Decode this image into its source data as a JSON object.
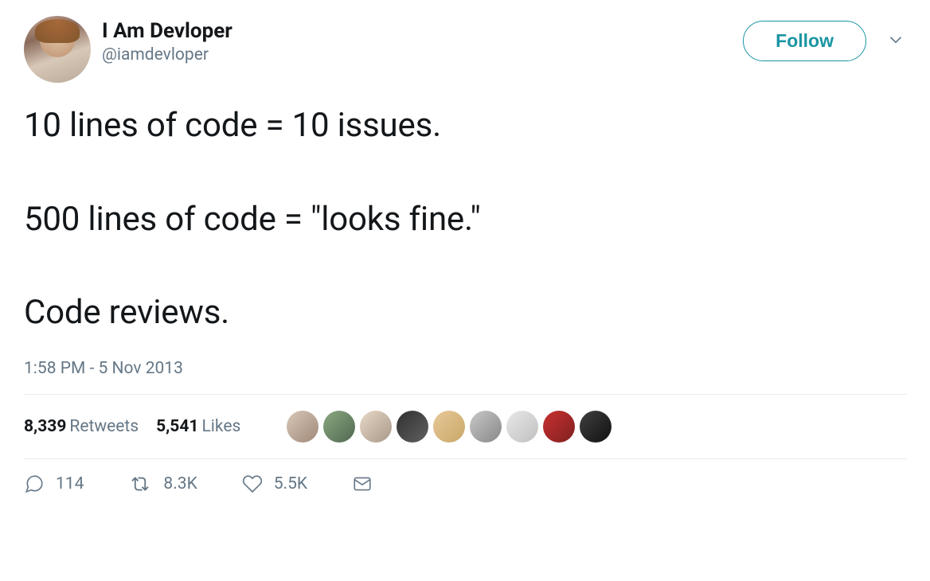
{
  "author": {
    "display_name": "I Am Devloper",
    "handle": "@iamdevloper"
  },
  "follow_label": "Follow",
  "tweet_text": "10 lines of code = 10 issues.\n\n500 lines of code = \"looks fine.\"\n\nCode reviews.",
  "timestamp": "1:58 PM - 5 Nov 2013",
  "stats": {
    "retweets_count": "8,339",
    "retweets_label": "Retweets",
    "likes_count": "5,541",
    "likes_label": "Likes"
  },
  "actions": {
    "replies": "114",
    "retweets": "8.3K",
    "likes": "5.5K"
  },
  "liker_colors": [
    "linear-gradient(135deg,#d8c8b8,#a08878)",
    "linear-gradient(135deg,#8aa880,#506850)",
    "linear-gradient(135deg,#e8d8c8,#a89888)",
    "linear-gradient(135deg,#303030,#606060)",
    "linear-gradient(135deg,#e8c898,#c8a868)",
    "linear-gradient(135deg,#c8c8c8,#888888)",
    "linear-gradient(135deg,#e8e8e8,#c0c0c0)",
    "linear-gradient(135deg,#c83030,#802020)",
    "linear-gradient(135deg,#404040,#101010)"
  ]
}
